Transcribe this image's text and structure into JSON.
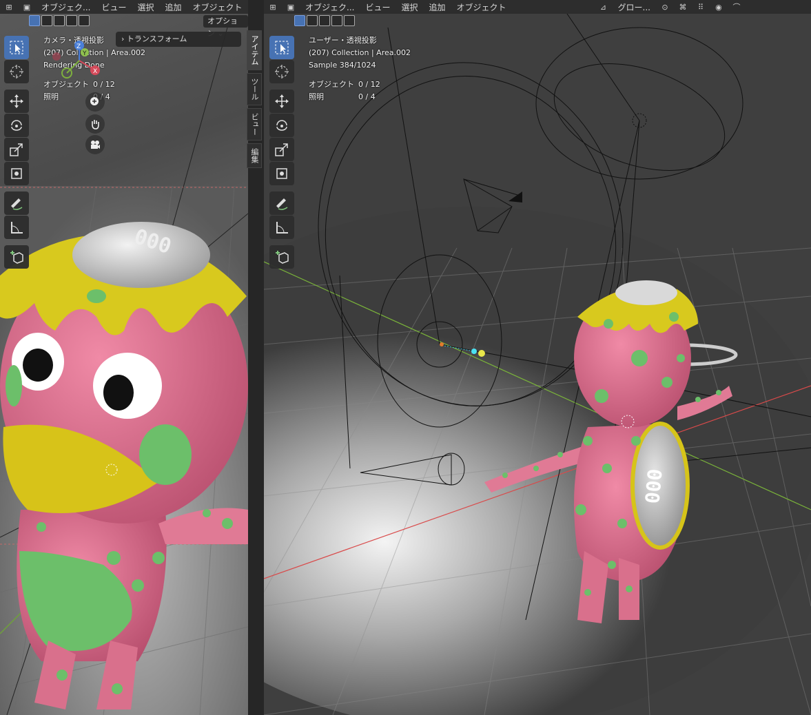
{
  "left": {
    "header": {
      "mode_label": "オブジェク...",
      "menus": [
        "ビュー",
        "選択",
        "追加",
        "オブジェクト"
      ]
    },
    "options_label": "オプション",
    "overlay": {
      "line1": "カメラ・透視投影",
      "line2": "(207) Collection | Area.002",
      "line3": "Rendering Done",
      "objects_label": "オブジェクト",
      "objects_value": "0 / 12",
      "lights_label": "照明",
      "lights_value": "0 / 4"
    },
    "transform_panel": {
      "label": "トランスフォーム"
    },
    "axis": {
      "x": "X",
      "y": "Y",
      "z": "Z"
    },
    "sidebar_tabs": [
      "アイテム",
      "ツール",
      "ビュー",
      "編集"
    ],
    "character_display": "000"
  },
  "right": {
    "header": {
      "mode_label": "オブジェク...",
      "menus": [
        "ビュー",
        "選択",
        "追加",
        "オブジェクト"
      ],
      "transform_orientation": "グロー..."
    },
    "overlay": {
      "line1": "ユーザー・透視投影",
      "line2": "(207) Collection | Area.002",
      "line3": "Sample 384/1024",
      "objects_label": "オブジェクト",
      "objects_value": "0 / 12",
      "lights_label": "照明",
      "lights_value": "0 / 4"
    },
    "character_display": "000"
  },
  "colors": {
    "accent": "#4772b3",
    "character_pink": "#e0708e",
    "character_yellow": "#d6c419",
    "dots_green": "#7cc97a",
    "axis_red": "#d94a4a",
    "axis_green": "#7ab33a"
  }
}
